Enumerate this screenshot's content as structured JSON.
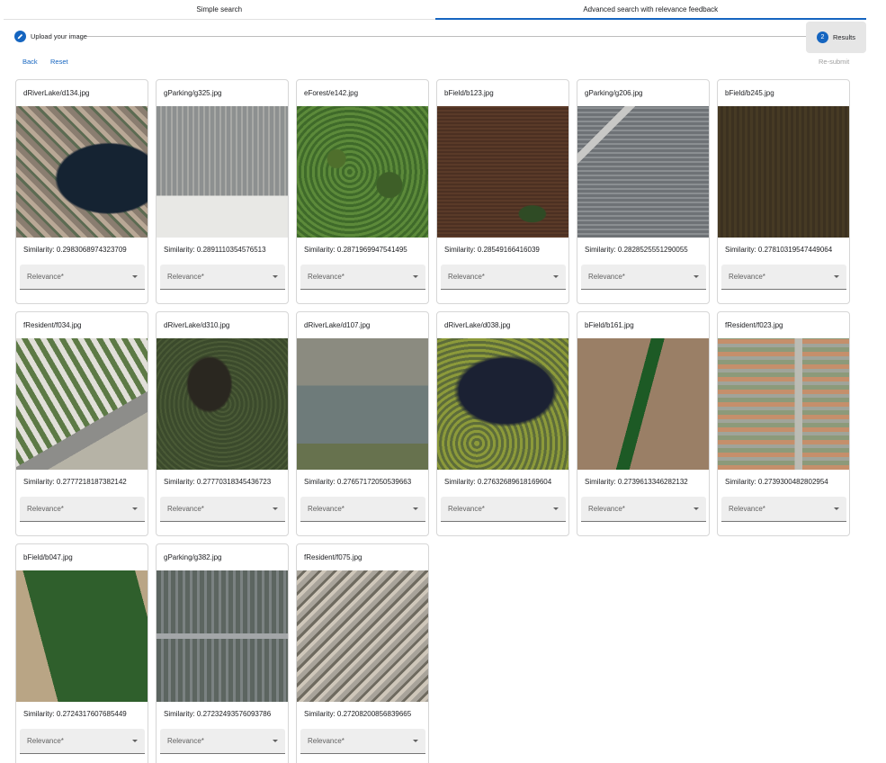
{
  "tabs": [
    {
      "label": "Simple search",
      "active": false
    },
    {
      "label": "Advanced search with relevance feedback",
      "active": true
    }
  ],
  "stepper": {
    "step1": {
      "icon": "pencil-icon",
      "label": "Upload your image"
    },
    "step2": {
      "number": "2",
      "label": "Results"
    }
  },
  "actions": {
    "back": "Back",
    "reset": "Reset",
    "resubmit": "Re-submit"
  },
  "colors": {
    "accent": "#1565c0",
    "select_bg": "#eeeeee",
    "card_border": "#d6d6d6"
  },
  "results": [
    {
      "title": "dRiverLake/d134.jpg",
      "similarity": "Similarity: 0.2983068974323709",
      "relevance": "Relevance*"
    },
    {
      "title": "gParking/g325.jpg",
      "similarity": "Similarity: 0.2891110354576513",
      "relevance": "Relevance*"
    },
    {
      "title": "eForest/e142.jpg",
      "similarity": "Similarity: 0.2871969947541495",
      "relevance": "Relevance*"
    },
    {
      "title": "bField/b123.jpg",
      "similarity": "Similarity: 0.28549166416039",
      "relevance": "Relevance*"
    },
    {
      "title": "gParking/g206.jpg",
      "similarity": "Similarity: 0.2828525551290055",
      "relevance": "Relevance*"
    },
    {
      "title": "bField/b245.jpg",
      "similarity": "Similarity: 0.27810319547449064",
      "relevance": "Relevance*"
    },
    {
      "title": "fResident/f034.jpg",
      "similarity": "Similarity: 0.2777218187382142",
      "relevance": "Relevance*"
    },
    {
      "title": "dRiverLake/d310.jpg",
      "similarity": "Similarity: 0.27770318345436723",
      "relevance": "Relevance*"
    },
    {
      "title": "dRiverLake/d107.jpg",
      "similarity": "Similarity: 0.27657172050539663",
      "relevance": "Relevance*"
    },
    {
      "title": "dRiverLake/d038.jpg",
      "similarity": "Similarity: 0.27632689618169604",
      "relevance": "Relevance*"
    },
    {
      "title": "bField/b161.jpg",
      "similarity": "Similarity: 0.2739613346282132",
      "relevance": "Relevance*"
    },
    {
      "title": "fResident/f023.jpg",
      "similarity": "Similarity: 0.2739300482802954",
      "relevance": "Relevance*"
    },
    {
      "title": "bField/b047.jpg",
      "similarity": "Similarity: 0.2724317607685449",
      "relevance": "Relevance*"
    },
    {
      "title": "gParking/g382.jpg",
      "similarity": "Similarity: 0.27232493576093786",
      "relevance": "Relevance*"
    },
    {
      "title": "fResident/f075.jpg",
      "similarity": "Similarity: 0.27208200856839665",
      "relevance": "Relevance*"
    }
  ]
}
